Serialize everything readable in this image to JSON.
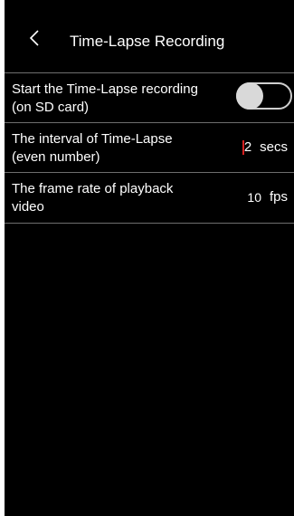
{
  "header": {
    "back_icon": "chevron-left-icon",
    "title": "Time-Lapse Recording"
  },
  "settings": {
    "start_recording": {
      "label_line1": "Start the Time-Lapse recording",
      "label_line2": "(on SD card)",
      "toggle_state": "off"
    },
    "interval": {
      "label_line1": "The interval of Time-Lapse",
      "label_line2": "(even number)",
      "value": "2",
      "unit": "secs"
    },
    "frame_rate": {
      "label_line1": "The frame rate of playback",
      "label_line2": "video",
      "value": "10",
      "unit": "fps"
    }
  },
  "colors": {
    "background": "#000000",
    "text": "#ffffff",
    "divider": "#6e6e6e",
    "caret": "#d62020",
    "toggle_knob": "#d9d9d9"
  }
}
